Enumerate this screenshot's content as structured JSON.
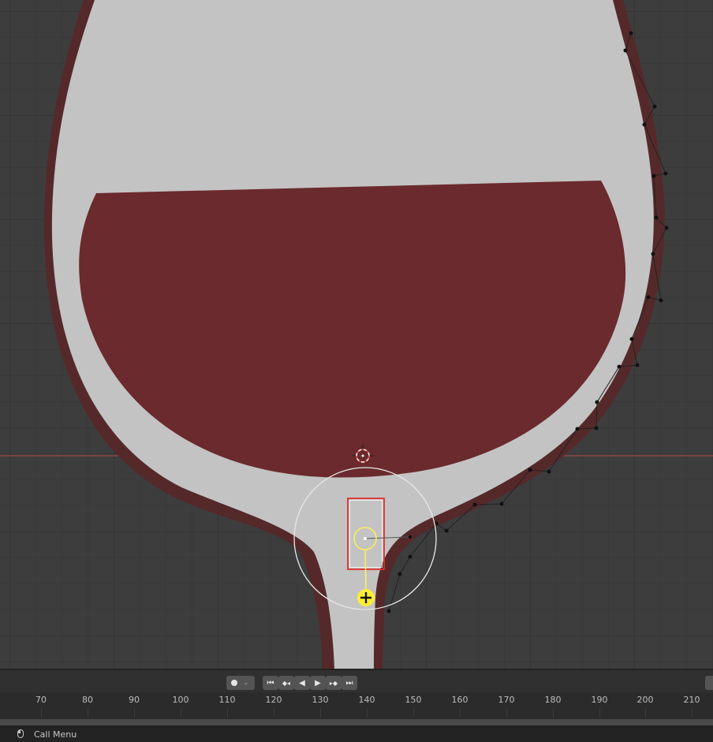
{
  "viewport": {
    "background": "#3d3d3d",
    "glass_color": "#c3c3c3",
    "glass_outline_color": "#5a2e2e",
    "wine_color": "#6b2a2d",
    "x_axis_color": "#b84a4a",
    "y_axis_color": "#5a5ab8",
    "selection_color": "#e03030",
    "gizmo_color": "#ffee55"
  },
  "playback": {
    "record_icon": "record-dot-icon",
    "buttons": [
      {
        "name": "jump-to-start-icon",
        "glyph": "⏮"
      },
      {
        "name": "jump-to-prev-keyframe-icon",
        "glyph": "◆◂"
      },
      {
        "name": "play-reverse-icon",
        "glyph": "◀"
      },
      {
        "name": "play-icon",
        "glyph": "▶"
      },
      {
        "name": "jump-to-next-keyframe-icon",
        "glyph": "▸◆"
      },
      {
        "name": "jump-to-end-icon",
        "glyph": "⏭"
      }
    ]
  },
  "timeline": {
    "frames": [
      "70",
      "80",
      "90",
      "100",
      "110",
      "120",
      "130",
      "140",
      "150",
      "160",
      "170",
      "180",
      "190",
      "200",
      "210"
    ]
  },
  "status_bar": {
    "mouse_icon": "mouse-icon",
    "hint": "Call Menu"
  }
}
